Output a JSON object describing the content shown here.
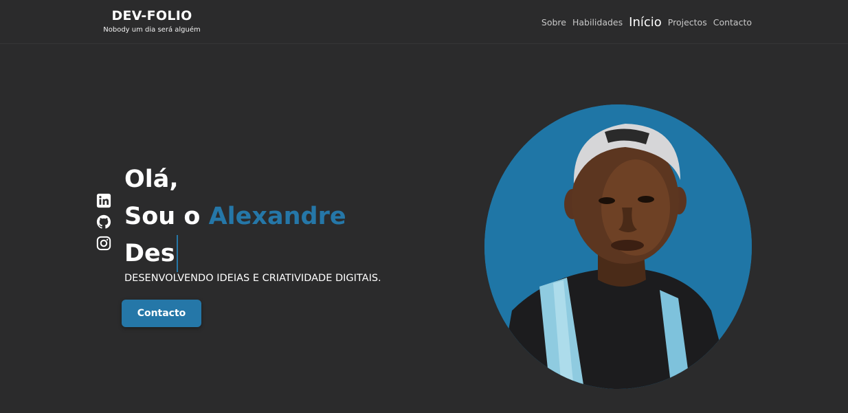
{
  "brand": {
    "title": "DEV-FOLIO",
    "tagline": "Nobody um dia será alguém"
  },
  "nav": {
    "items": [
      {
        "label": "Sobre",
        "active": false
      },
      {
        "label": "Habilidades",
        "active": false
      },
      {
        "label": "Início",
        "active": true
      },
      {
        "label": "Projectos",
        "active": false
      },
      {
        "label": "Contacto",
        "active": false
      }
    ]
  },
  "socials": [
    {
      "icon": "linkedin-icon"
    },
    {
      "icon": "github-icon"
    },
    {
      "icon": "instagram-icon"
    }
  ],
  "hero": {
    "greeting": "Olá,",
    "intro_prefix": "Sou o ",
    "name": "Alexandre",
    "typing_text": "Des",
    "subtitle": "DESENVOLVENDO IDEIAS E CRIATIVIDADE DIGITAIS.",
    "cta_label": "Contacto"
  },
  "colors": {
    "background": "#2b2b2c",
    "accent": "#2577a8",
    "text": "#ffffff",
    "nav_text": "#c9c9c9"
  }
}
